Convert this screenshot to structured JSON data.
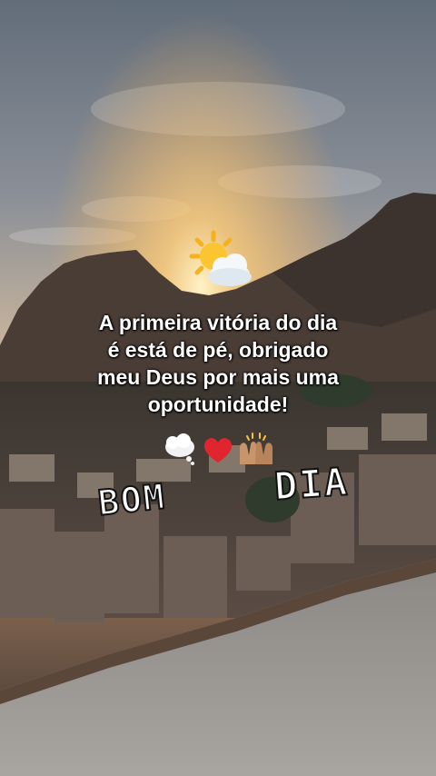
{
  "greeting": {
    "word1": "BOM",
    "word2": "DIA",
    "sun_icon": "sun-behind-cloud-emoji"
  },
  "message": {
    "lines": [
      "A primeira vitória do dia",
      "é está de pé, obrigado",
      "meu Deus por mais uma",
      "oportunidade!"
    ]
  },
  "emojis": [
    "thought-balloon-emoji",
    "red-heart-emoji",
    "raised-hands-emoji"
  ],
  "colors": {
    "text": "#ffffff",
    "sky_top": "#6f7986",
    "sunset": "#f3b25c"
  }
}
